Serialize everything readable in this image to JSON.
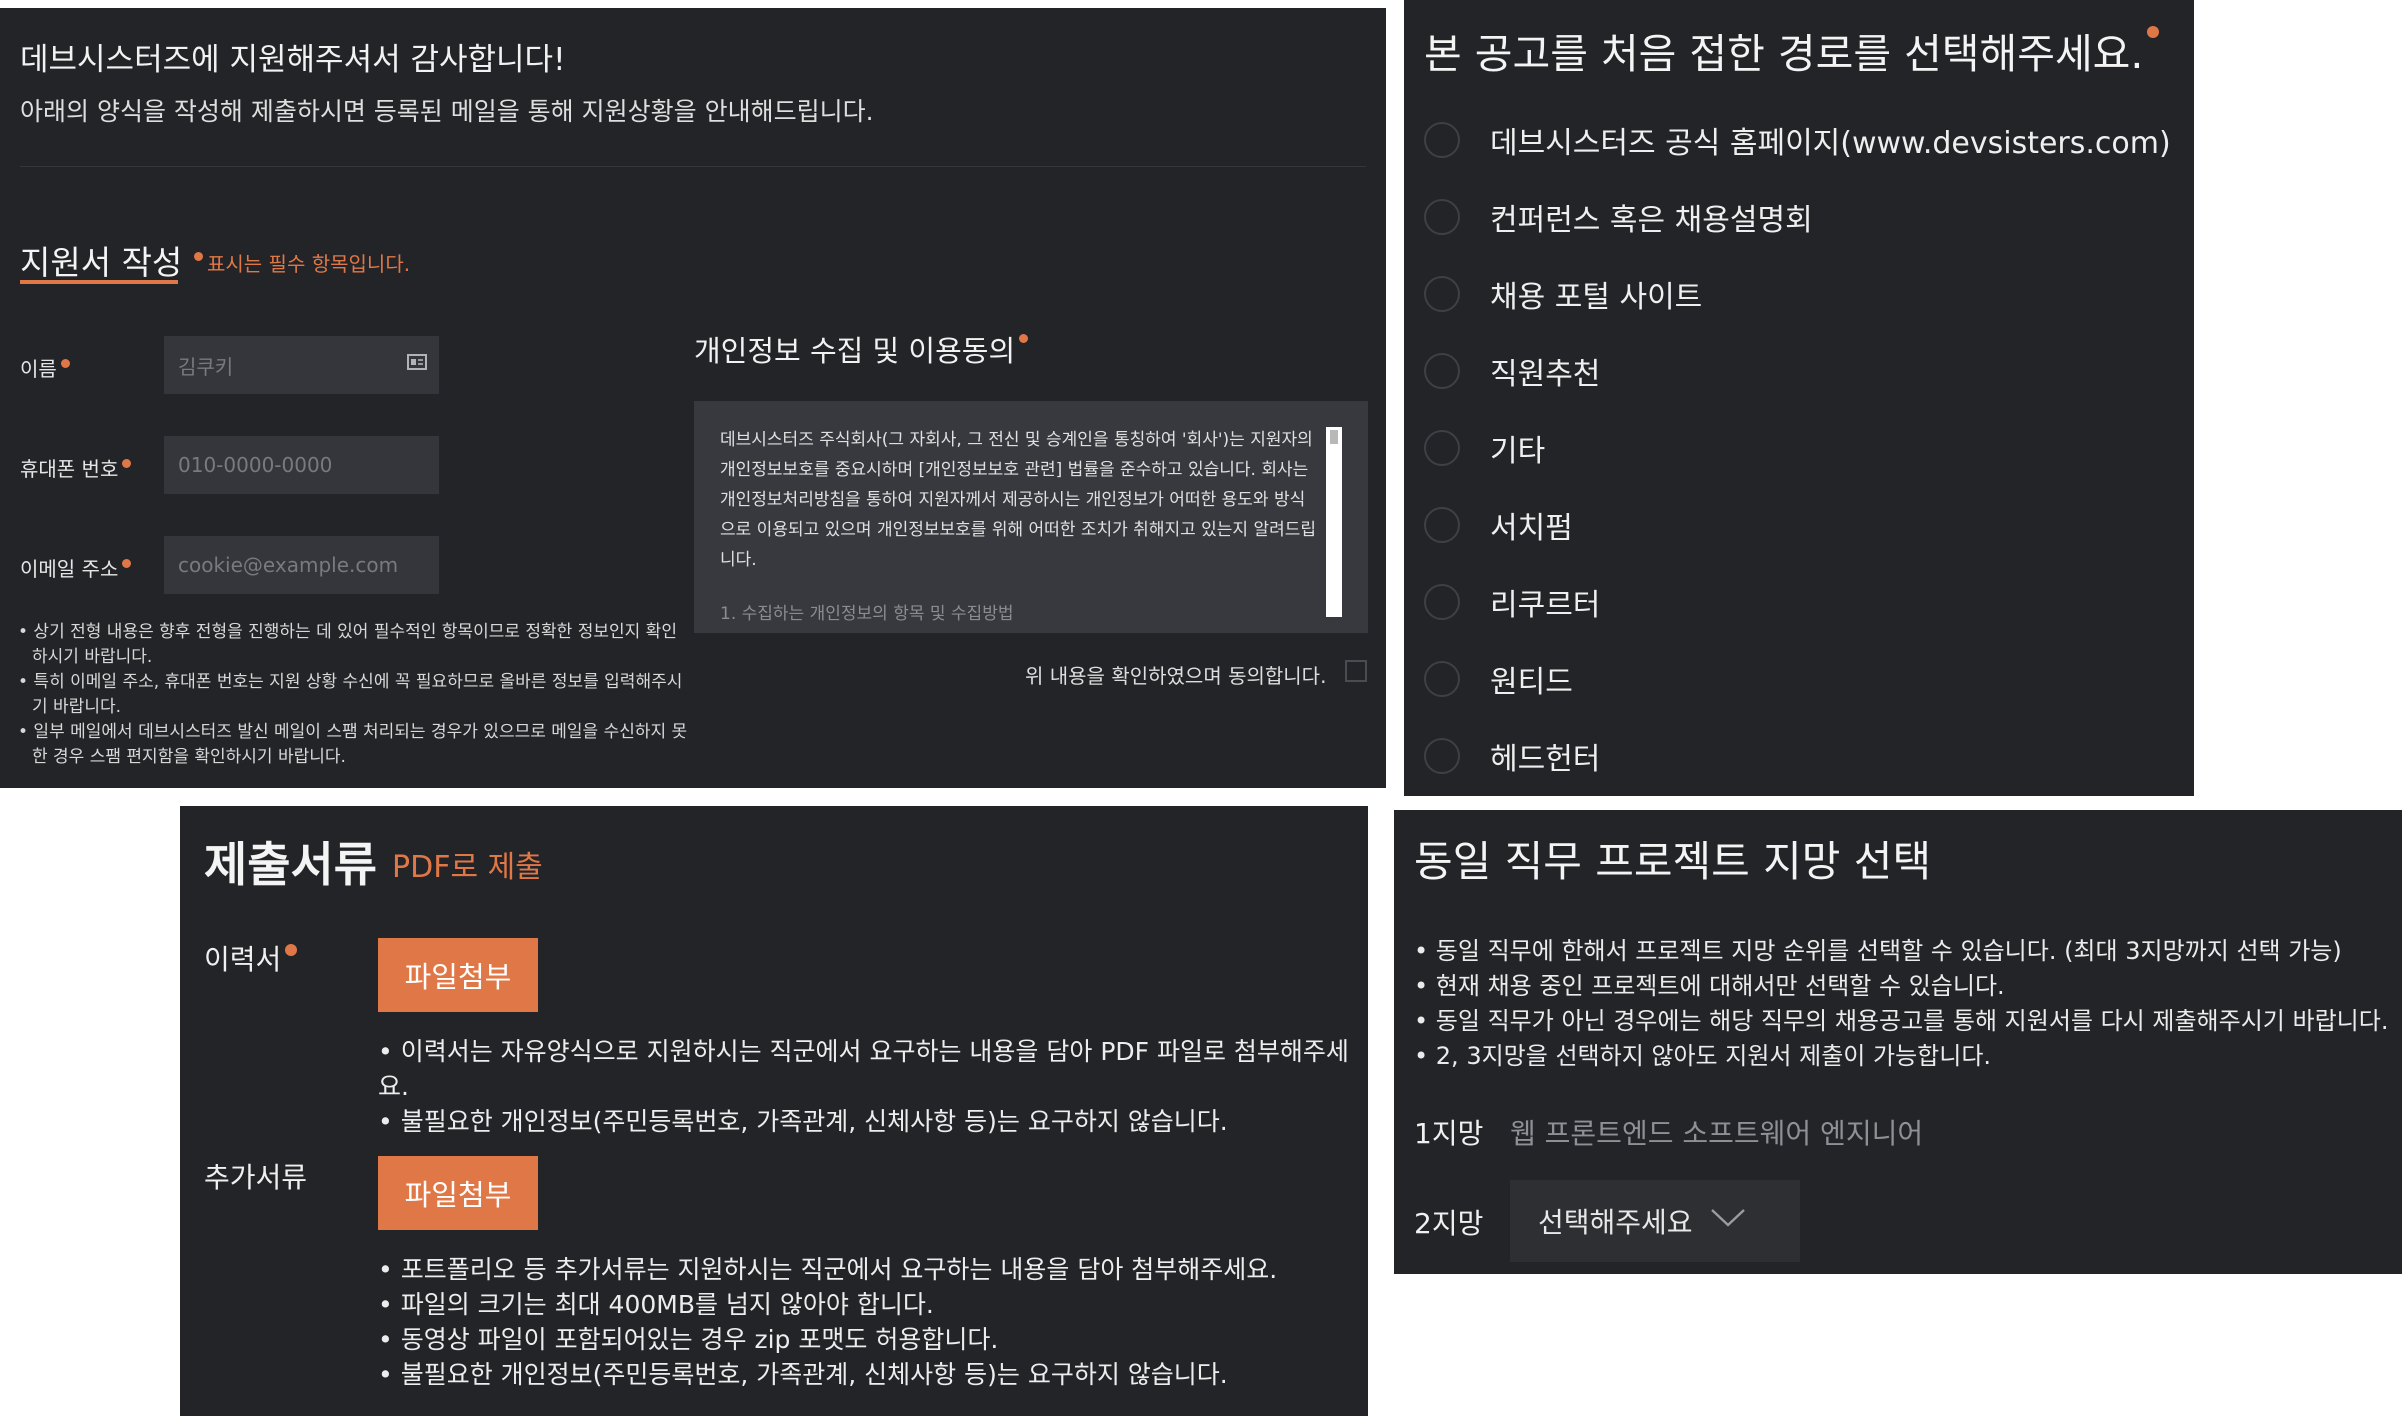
{
  "intro": {
    "title": "데브시스터즈에 지원해주셔서 감사합니다!",
    "subtitle": "아래의 양식을 작성해 제출하시면 등록된 메일을 통해 지원상황을 안내해드립니다."
  },
  "form": {
    "title": "지원서 작성",
    "required_note": "표시는 필수 항목입니다.",
    "fields": [
      {
        "label": "이름",
        "placeholder": "김쿠키"
      },
      {
        "label": "휴대폰 번호",
        "placeholder": "010-0000-0000"
      },
      {
        "label": "이메일 주소",
        "placeholder": "cookie@example.com"
      }
    ],
    "notes": [
      "• 상기 전형 내용은 향후 전형을 진행하는 데 있어 필수적인 항목이므로 정확한 정보인지 확인하시기 바랍니다.",
      "• 특히 이메일 주소, 휴대폰 번호는 지원 상황 수신에 꼭 필요하므로 올바른 정보를 입력해주시기 바랍니다.",
      "• 일부 메일에서 데브시스터즈 발신 메일이 스팸 처리되는 경우가 있으므로 메일을 수신하지 못한 경우 스팸 편지함을 확인하시기 바랍니다."
    ]
  },
  "privacy": {
    "title": "개인정보 수집 및 이용동의",
    "body": "데브시스터즈 주식회사(그 자회사, 그 전신 및 승계인을 통칭하여 '회사')는 지원자의 개인정보보호를 중요시하며 [개인정보보호 관련] 법률을 준수하고 있습니다. 회사는 개인정보처리방침을 통하여 지원자께서 제공하시는 개인정보가 어떠한 용도와 방식으로 이용되고 있으며 개인정보보호를 위해 어떠한 조치가 취해지고 있는지 알려드립니다.",
    "faded": "1. 수집하는 개인정보의 항목 및 수집방법",
    "agree_label": "위 내용을 확인하였으며 동의합니다."
  },
  "source_question": {
    "title": "본 공고를 처음 접한 경로를 선택해주세요.",
    "options": [
      "데브시스터즈 공식 홈페이지(www.devsisters.com)",
      "컨퍼런스 혹은 채용설명회",
      "채용 포털 사이트",
      "직원추천",
      "기타",
      "서치펌",
      "리쿠르터",
      "원티드",
      "헤드헌터"
    ]
  },
  "documents": {
    "title": "제출서류",
    "subtitle": "PDF로 제출",
    "resume_label": "이력서",
    "extra_label": "추가서류",
    "attach_label": "파일첨부",
    "resume_notes": [
      "• 이력서는 자유양식으로 지원하시는 직군에서 요구하는 내용을 담아 PDF 파일로 첨부해주세요.",
      "• 불필요한 개인정보(주민등록번호, 가족관계, 신체사항 등)는 요구하지 않습니다."
    ],
    "extra_notes": [
      "• 포트폴리오 등 추가서류는 지원하시는 직군에서 요구하는 내용을 담아 첨부해주세요.",
      "• 파일의 크기는 최대 400MB를 넘지 않아야 합니다.",
      "• 동영상 파일이 포함되어있는 경우 zip 포맷도 허용합니다.",
      "• 불필요한 개인정보(주민등록번호, 가족관계, 신체사항 등)는 요구하지 않습니다."
    ]
  },
  "projects": {
    "title": "동일 직무 프로젝트 지망 선택",
    "notes": [
      "• 동일 직무에 한해서 프로젝트 지망 순위를 선택할 수 있습니다. (최대 3지망까지 선택 가능)",
      "• 현재 채용 중인 프로젝트에 대해서만 선택할 수 있습니다.",
      "• 동일 직무가 아닌 경우에는 해당 직무의 채용공고를 통해 지원서를 다시 제출해주시기 바랍니다.",
      "• 2, 3지망을 선택하지 않아도 지원서 제출이 가능합니다."
    ],
    "first_label": "1지망",
    "first_value": "웹 프론트엔드 소프트웨어 엔지니어",
    "second_label": "2지망",
    "second_placeholder": "선택해주세요"
  },
  "colors": {
    "panel_bg": "#232428",
    "accent": "#e07747",
    "input_bg": "#34363b"
  },
  "icons": {
    "name_field": "id-card-icon",
    "select": "chevron-down-icon",
    "required": "required-dot-icon"
  }
}
